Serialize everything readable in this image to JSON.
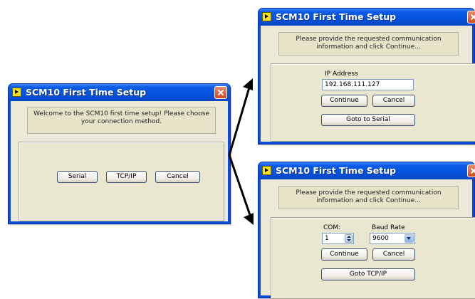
{
  "window_title": "SCM10 First Time Setup",
  "dialog_main": {
    "message": "Welcome to the SCM10 first time setup!  Please choose your connection method.",
    "buttons": {
      "serial": "Serial",
      "tcpip": "TCP/IP",
      "cancel": "Cancel"
    }
  },
  "dialog_tcpip": {
    "message": "Please provide the requested communication information and click Continue...",
    "ip_label": "IP Address",
    "ip_value": "192.168.111.127",
    "buttons": {
      "continue": "Continue",
      "cancel": "Cancel",
      "switch": "Goto to Serial"
    }
  },
  "dialog_serial": {
    "message": "Please provide the requested communication information and click Continue...",
    "com_label": "COM:",
    "com_value": "1",
    "baud_label": "Baud Rate",
    "baud_value": "9600",
    "buttons": {
      "continue": "Continue",
      "cancel": "Cancel",
      "switch": "Goto TCP/IP"
    }
  },
  "colors": {
    "titlebar": "#0553de",
    "client": "#ece9d8",
    "close": "#d14a1e",
    "arrow": "#000000"
  },
  "icons": [
    "labview-app-icon",
    "close-icon",
    "spinner-icon",
    "dropdown-arrow-icon",
    "arrow-icon"
  ]
}
